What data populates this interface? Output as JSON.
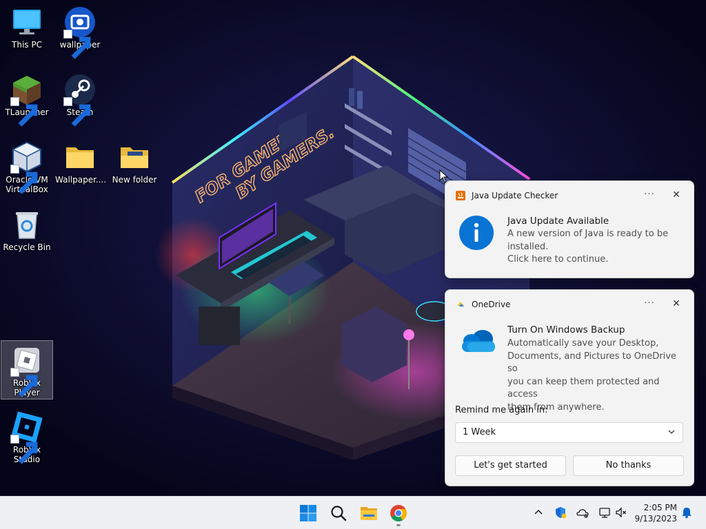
{
  "desktop": {
    "icons": [
      {
        "label": "This PC"
      },
      {
        "label": "wallpaper"
      },
      {
        "label": "TLauncher"
      },
      {
        "label": "Steam"
      },
      {
        "label": "Oracle VM\nVirtualBox"
      },
      {
        "label": "Wallpaper...."
      },
      {
        "label": "New folder"
      },
      {
        "label": "Recycle Bin"
      },
      {
        "label": "Roblox Player"
      },
      {
        "label": "Roblox Studio"
      }
    ],
    "wallpaper_text": {
      "line1": "FOR GAMERS.",
      "line2": "BY GAMERS."
    }
  },
  "notifications": {
    "java": {
      "app_name": "Java Update Checker",
      "more_label": "···",
      "close_label": "✕",
      "title": "Java Update Available",
      "body_line1": "A new version of Java is ready to be",
      "body_line2": "installed.",
      "body_line3": "Click here to continue."
    },
    "onedrive": {
      "app_name": "OneDrive",
      "more_label": "···",
      "close_label": "✕",
      "title": "Turn On Windows Backup",
      "body_line1": "Automatically save your Desktop,",
      "body_line2": "Documents, and Pictures to OneDrive so",
      "body_line3": "you can keep them protected and access",
      "body_line4": "them from anywhere.",
      "remind_label": "Remind me again in:",
      "remind_value": "1 Week",
      "primary_button": "Let's get started",
      "secondary_button": "No thanks"
    }
  },
  "taskbar": {
    "clock_time": "2:05 PM",
    "clock_date": "9/13/2023",
    "apps": [
      "start-icon",
      "search-icon",
      "file-explorer-icon",
      "chrome-icon"
    ],
    "tray": [
      "chevron-up-icon",
      "defender-icon",
      "onedrive-tray-icon",
      "network-icon",
      "volume-muted-icon",
      "notification-bell-icon"
    ]
  },
  "colors": {
    "accent": "#0078d4",
    "taskbar_bg": "#eef0f4",
    "toast_bg": "#f3f3f3"
  }
}
